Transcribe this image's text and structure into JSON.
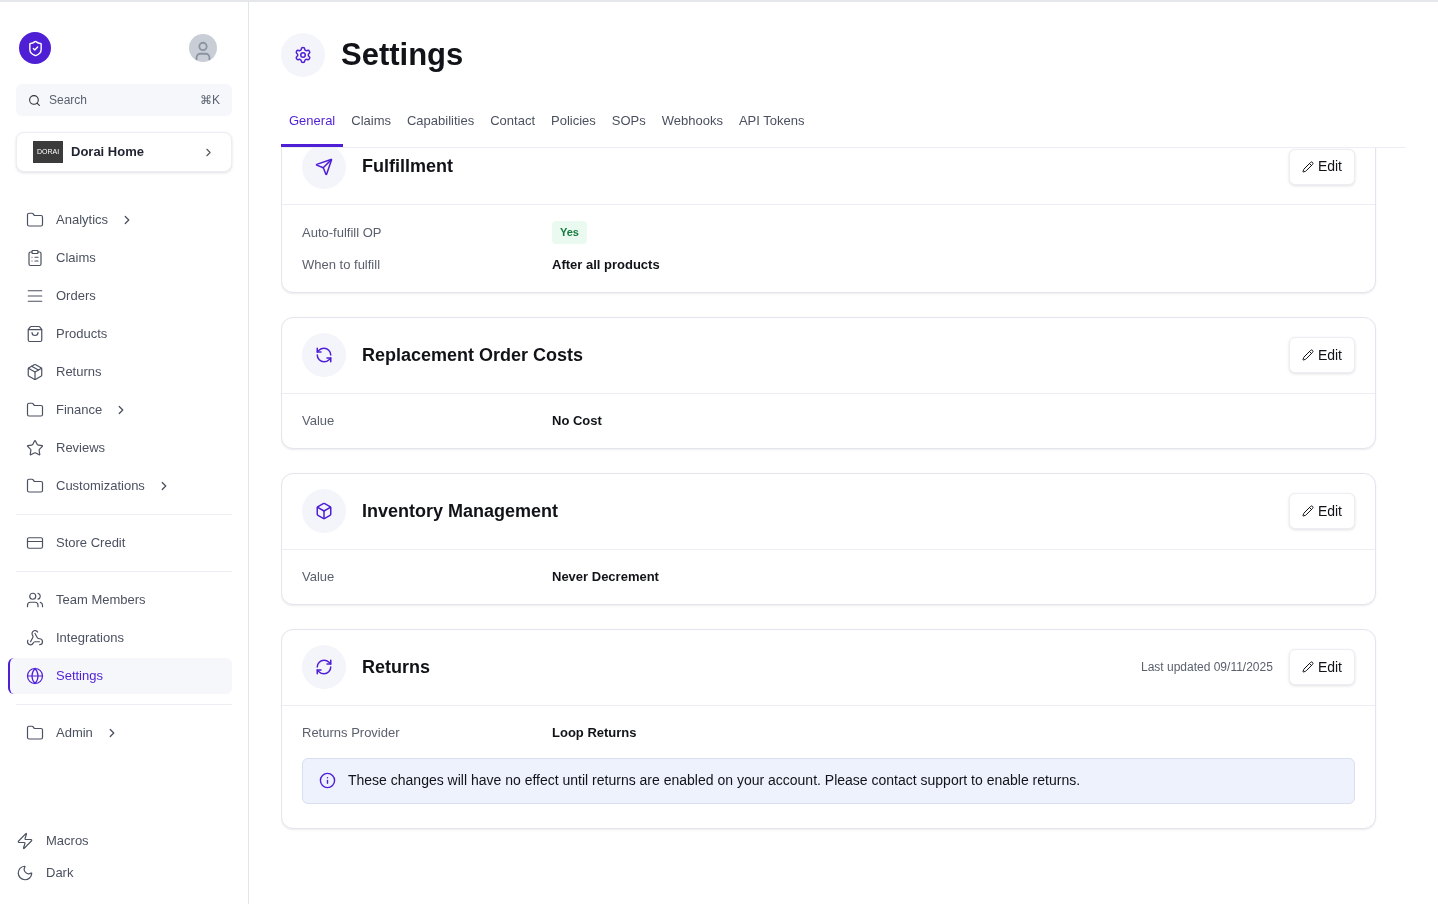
{
  "sidebar": {
    "search": {
      "placeholder": "Search",
      "shortcut": "⌘K"
    },
    "store": {
      "name": "Dorai Home",
      "logo_text": "DORAI"
    },
    "groups": [
      {
        "items": [
          {
            "label": "Analytics",
            "expandable": true,
            "selected": false
          },
          {
            "label": "Claims",
            "expandable": false,
            "selected": false
          },
          {
            "label": "Orders",
            "expandable": false,
            "selected": false
          },
          {
            "label": "Products",
            "expandable": false,
            "selected": false
          },
          {
            "label": "Returns",
            "expandable": false,
            "selected": false
          },
          {
            "label": "Finance",
            "expandable": true,
            "selected": false
          },
          {
            "label": "Reviews",
            "expandable": false,
            "selected": false
          },
          {
            "label": "Customizations",
            "expandable": true,
            "selected": false
          }
        ]
      },
      {
        "items": [
          {
            "label": "Store Credit",
            "expandable": false,
            "selected": false
          }
        ]
      },
      {
        "items": [
          {
            "label": "Team Members",
            "expandable": false,
            "selected": false
          },
          {
            "label": "Integrations",
            "expandable": false,
            "selected": false
          },
          {
            "label": "Settings",
            "expandable": false,
            "selected": true
          }
        ]
      },
      {
        "items": [
          {
            "label": "Admin",
            "expandable": true,
            "selected": false
          }
        ]
      }
    ],
    "footer": [
      "Macros",
      "Dark"
    ]
  },
  "page": {
    "title": "Settings"
  },
  "tabs": [
    {
      "label": "General",
      "selected": true
    },
    {
      "label": "Claims",
      "selected": false
    },
    {
      "label": "Capabilities",
      "selected": false
    },
    {
      "label": "Contact",
      "selected": false
    },
    {
      "label": "Policies",
      "selected": false
    },
    {
      "label": "SOPs",
      "selected": false
    },
    {
      "label": "Webhooks",
      "selected": false
    },
    {
      "label": "API Tokens",
      "selected": false
    }
  ],
  "cards": [
    {
      "title": "Fulfillment",
      "edit": "Edit",
      "fields": [
        {
          "label": "Auto-fulfill OP",
          "value": "Yes",
          "kind": "badge"
        },
        {
          "label": "When to fulfill",
          "value": "After all products",
          "kind": "text"
        }
      ]
    },
    {
      "title": "Replacement Order Costs",
      "edit": "Edit",
      "fields": [
        {
          "label": "Value",
          "value": "No Cost",
          "kind": "text"
        }
      ]
    },
    {
      "title": "Inventory Management",
      "edit": "Edit",
      "fields": [
        {
          "label": "Value",
          "value": "Never Decrement",
          "kind": "text"
        }
      ]
    },
    {
      "title": "Returns",
      "edit": "Edit",
      "last_updated": "Last updated 09/11/2025",
      "fields": [
        {
          "label": "Returns Provider",
          "value": "Loop Returns",
          "kind": "text"
        }
      ],
      "notice": "These changes will have no effect until returns are enabled on your account. Please contact support to enable returns."
    }
  ]
}
